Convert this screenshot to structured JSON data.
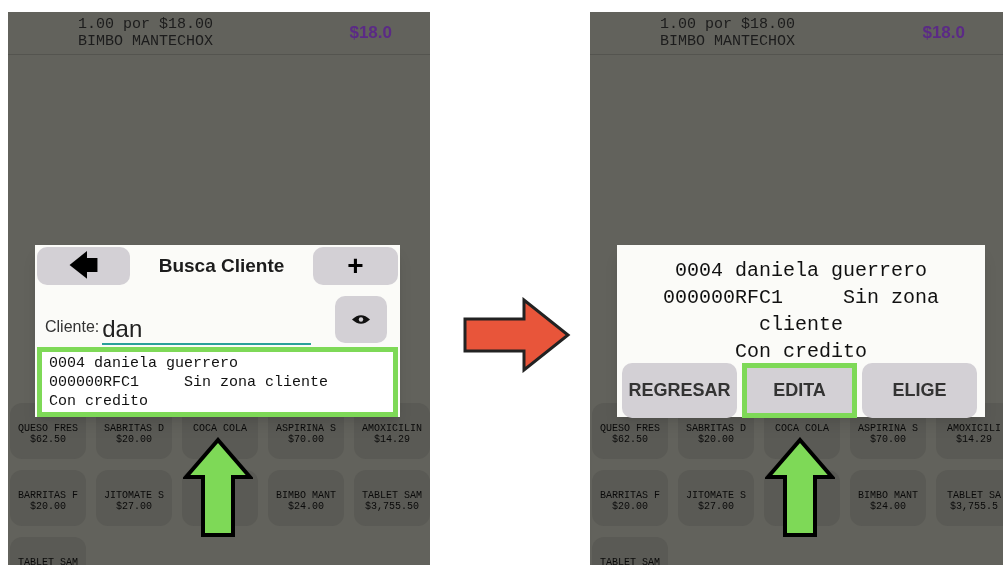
{
  "screens": [
    {
      "header": {
        "line_1": "1.00 por $18.00",
        "line_2": "BIMBO MANTECHOX",
        "total": "$18.0"
      },
      "dialog": {
        "kind": "search",
        "back_icon": "🡄",
        "title": "Busca Cliente",
        "add_label": "+",
        "field_label": "Cliente:",
        "field_value": "dan",
        "result": {
          "highlighted": true,
          "lines": [
            "0004 daniela guerrero",
            "000000RFC1     Sin zona cliente",
            "Con credito"
          ]
        }
      },
      "tiles": [
        {
          "kind": "product",
          "name": "QUESO FRES",
          "price": "$62.50"
        },
        {
          "kind": "product",
          "name": "SABRITAS D",
          "price": "$20.00"
        },
        {
          "kind": "product",
          "name": "COCA COLA"
        },
        {
          "kind": "product",
          "name": "ASPIRINA S",
          "price": "$70.00"
        },
        {
          "kind": "product",
          "name": "AMOXICILIN",
          "price": "$14.29"
        },
        {
          "kind": "product",
          "name": "BARRITAS F",
          "price": "$20.00"
        },
        {
          "kind": "product",
          "name": "JITOMATE S",
          "price": "$27.00"
        },
        {
          "kind": "blank"
        },
        {
          "kind": "product",
          "name": "BIMBO MANT",
          "price": "$24.00"
        },
        {
          "kind": "product",
          "name": "TABLET SAM",
          "price": "$3,755.50"
        },
        {
          "kind": "product",
          "name": "TABLET SAM"
        }
      ]
    },
    {
      "header": {
        "line_1": "1.00 por $18.00",
        "line_2": "BIMBO MANTECHOX",
        "total": "$18.0"
      },
      "dialog": {
        "kind": "detail",
        "lines": [
          "0004 daniela guerrero",
          "000000RFC1     Sin zona",
          "cliente",
          "Con credito"
        ],
        "buttons": [
          {
            "label": "REGRESAR",
            "highlighted": false
          },
          {
            "label": "EDITA",
            "highlighted": true
          },
          {
            "label": "ELIGE",
            "highlighted": false
          }
        ]
      },
      "tiles": [
        {
          "kind": "product",
          "name": "QUESO FRES",
          "price": "$62.50"
        },
        {
          "kind": "product",
          "name": "SABRITAS D",
          "price": "$20.00"
        },
        {
          "kind": "product",
          "name": "COCA COLA"
        },
        {
          "kind": "product",
          "name": "ASPIRINA S",
          "price": "$70.00"
        },
        {
          "kind": "product",
          "name": "AMOXICILI",
          "price": "$14.29"
        },
        {
          "kind": "product",
          "name": "BARRITAS F",
          "price": "$20.00"
        },
        {
          "kind": "product",
          "name": "JITOMATE S",
          "price": "$27.00"
        },
        {
          "kind": "blank"
        },
        {
          "kind": "product",
          "name": "BIMBO MANT",
          "price": "$24.00"
        },
        {
          "kind": "product",
          "name": "TABLET SA",
          "price": "$3,755.5"
        },
        {
          "kind": "product",
          "name": "TABLET SAM"
        }
      ]
    }
  ]
}
